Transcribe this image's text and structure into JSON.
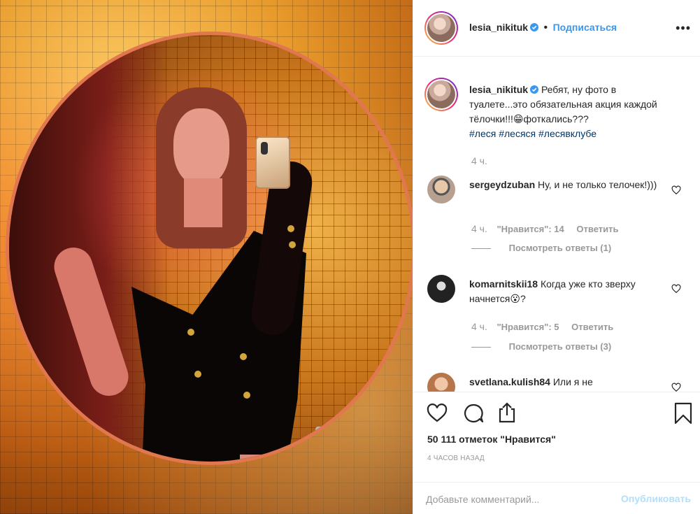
{
  "post": {
    "author": "lesia_nikituk",
    "verified": true,
    "follow_label": "Подписаться",
    "dot": "•",
    "more_label": "•••"
  },
  "caption": {
    "author": "lesia_nikituk",
    "text": "Ребят, ну фото в туалете...это обязательная акция каждой тёлочки!!!😁фоткались???",
    "hashtags": [
      "#леся",
      "#лесяся",
      "#лесявклубе"
    ],
    "time": "4 ч."
  },
  "comments": [
    {
      "user": "sergeydzuban",
      "text": "Ну, и не только телочек!)))",
      "time": "4 ч.",
      "likes": "\"Нравится\": 14",
      "reply": "Ответить",
      "view_replies": "Посмотреть ответы (1)"
    },
    {
      "user": "komarnitskii18",
      "text": "Когда уже кто зверху начнется😮?",
      "time": "4 ч.",
      "likes": "\"Нравится\": 5",
      "reply": "Ответить",
      "view_replies": "Посмотреть ответы (3)"
    },
    {
      "user": "svetlana.kulish84",
      "text": "Или я не"
    }
  ],
  "actions": {
    "likes_count": "50 111 отметок \"Нравится\"",
    "time_ago": "4 часов назад"
  },
  "add_comment": {
    "placeholder": "Добавьте комментарий...",
    "publish_label": "Опубликовать"
  },
  "colors": {
    "accent": "#3897f0",
    "hashtag": "#003569",
    "publish_disabled": "#b2dffc",
    "muted": "#999999"
  },
  "icons": [
    "verified-badge-icon",
    "more-icon",
    "heart-icon",
    "comment-icon",
    "share-icon",
    "bookmark-icon"
  ]
}
